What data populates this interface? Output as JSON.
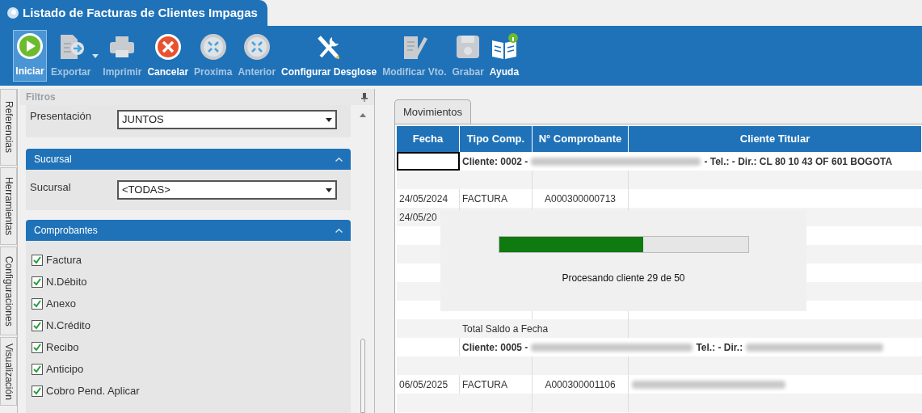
{
  "window": {
    "title": "Listado de Facturas de Clientes Impagas"
  },
  "toolbar": [
    {
      "label": "Iniciar",
      "kind": "play",
      "disabled": false,
      "selected": true
    },
    {
      "label": "Exportar",
      "kind": "export",
      "disabled": true,
      "selected": false,
      "dropdown": true
    },
    {
      "label": "Imprimir",
      "kind": "print",
      "disabled": true,
      "selected": false
    },
    {
      "label": "Cancelar",
      "kind": "cancel",
      "disabled": false,
      "selected": false
    },
    {
      "label": "Proxima",
      "kind": "expand",
      "disabled": true,
      "selected": false
    },
    {
      "label": "Anterior",
      "kind": "collapse",
      "disabled": true,
      "selected": false
    },
    {
      "label": "Configurar Desglose",
      "kind": "tools",
      "disabled": false,
      "selected": false
    },
    {
      "label": "Modificar Vto.",
      "kind": "edit",
      "disabled": true,
      "selected": false
    },
    {
      "label": "Grabar",
      "kind": "save",
      "disabled": true,
      "selected": false
    },
    {
      "label": "Ayuda",
      "kind": "help",
      "disabled": false,
      "selected": false
    }
  ],
  "side_tabs": [
    "Referencias",
    "Herramientas",
    "Configuraciones",
    "Visualización"
  ],
  "filters": {
    "title": "Filtros",
    "presentacion": {
      "label": "Presentación",
      "value": "JUNTOS"
    },
    "sucursal": {
      "title": "Sucursal",
      "label": "Sucursal",
      "value": "<TODAS>"
    },
    "comprobantes": {
      "title": "Comprobantes",
      "items": [
        {
          "label": "Factura",
          "checked": true
        },
        {
          "label": "N.Débito",
          "checked": true
        },
        {
          "label": "Anexo",
          "checked": true
        },
        {
          "label": "N.Crédito",
          "checked": true
        },
        {
          "label": "Recibo",
          "checked": true
        },
        {
          "label": "Anticipo",
          "checked": true
        },
        {
          "label": "Cobro Pend. Aplicar",
          "checked": true
        }
      ]
    }
  },
  "tab": {
    "label": "Movimientos",
    "selected": true
  },
  "table": {
    "columns": [
      "Fecha",
      "Tipo Comp.",
      "N° Comprobante",
      "Cliente Titular"
    ],
    "rows": [
      {
        "kind": "client",
        "client": "Cliente: 0002 -",
        "detail": "- Tel.:  - Dir.: CL 80 10 43 OF 601 BOGOTA",
        "blur_detail": false
      },
      {
        "kind": "empty"
      },
      {
        "kind": "doc",
        "fecha": "24/05/2024",
        "tipo": "FACTURA",
        "numero": "A000300000713",
        "blur_name": false
      },
      {
        "kind": "doc",
        "fecha": "24/05/20"
      },
      {
        "kind": "empty"
      },
      {
        "kind": "empty"
      },
      {
        "kind": "empty"
      },
      {
        "kind": "empty"
      },
      {
        "kind": "empty"
      },
      {
        "kind": "total",
        "label": "Total Saldo a Fecha"
      },
      {
        "kind": "client",
        "client": "Cliente: 0005 -",
        "detail": "Tel.:  - Dir.:",
        "blur_detail": true
      },
      {
        "kind": "empty"
      },
      {
        "kind": "doc",
        "fecha": "06/05/2025",
        "tipo": "FACTURA",
        "numero": "A000300001106",
        "blur_name": true
      },
      {
        "kind": "empty"
      }
    ]
  },
  "progress": {
    "level": 0.58,
    "message": "Procesando cliente 29 de 50"
  }
}
